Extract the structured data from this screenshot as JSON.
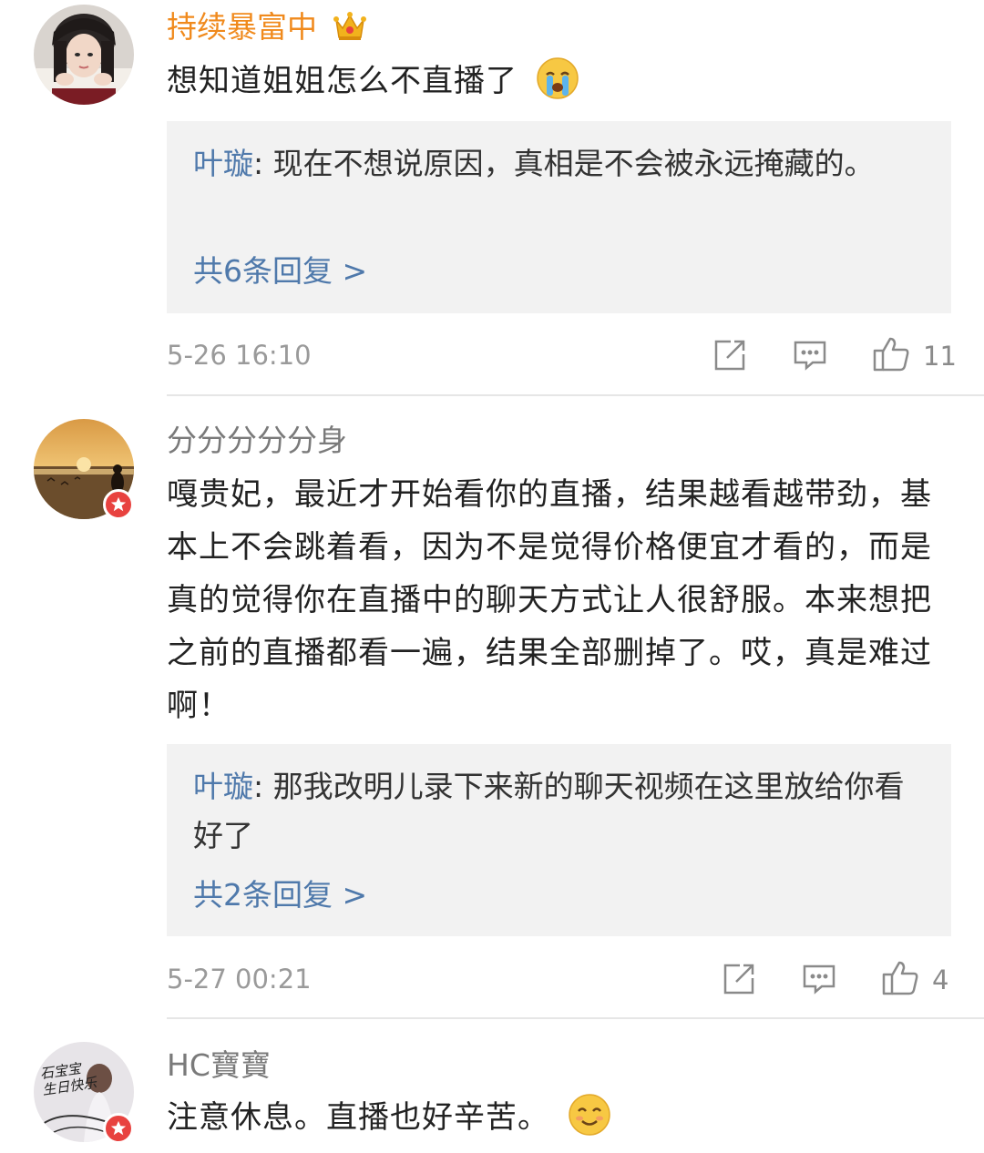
{
  "comments": [
    {
      "username": "持续暴富中",
      "content": "想知道姐姐怎么不直播了",
      "reply_preview": {
        "author": "叶璇",
        "separator": ": ",
        "text": "现在不想说原因，真相是不会被永远掩藏的。"
      },
      "more_replies": "共6条回复 >",
      "time": "5-26 16:10",
      "likes": "11"
    },
    {
      "username": "分分分分分身",
      "content": "嘎贵妃，最近才开始看你的直播，结果越看越带劲，基本上不会跳着看，因为不是觉得价格便宜才看的，而是真的觉得你在直播中的聊天方式让人很舒服。本来想把之前的直播都看一遍，结果全部删掉了。哎，真是难过啊！",
      "reply_preview": {
        "author": "叶璇",
        "separator": ": ",
        "text": "那我改明儿录下来新的聊天视频在这里放给你看好了"
      },
      "more_replies": "共2条回复 >",
      "time": "5-27 00:21",
      "likes": "4"
    },
    {
      "username": "HC寶寶",
      "content": "注意休息。直播也好辛苦。"
    }
  ],
  "avatar_text": {
    "line1": "石宝宝",
    "line2": "生日快乐"
  },
  "colors": {
    "vip_name": "#f08a1d",
    "reply_link": "#4f79ab",
    "reply_bg": "#f2f2f2",
    "badge": "#e8423f"
  },
  "icons": [
    "crown-icon",
    "crying-emoji-icon",
    "repost-icon",
    "comment-icon",
    "like-icon",
    "verified-badge-icon",
    "smile-emoji-icon"
  ]
}
